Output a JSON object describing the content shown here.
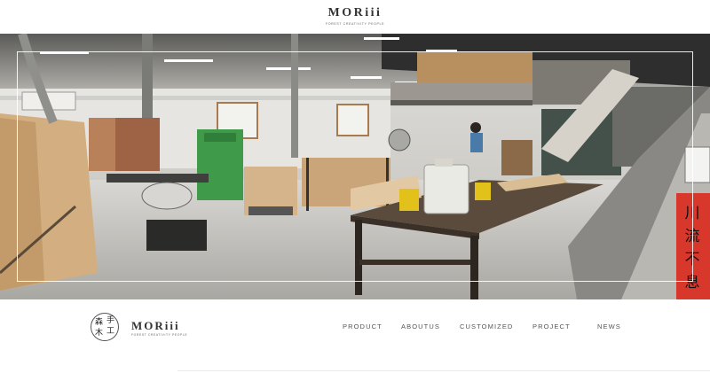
{
  "brand": {
    "wordmark": "MORiii",
    "tagline": "FOREST CREATIVITY PEOPLE",
    "seal_chars": [
      "森",
      "手",
      "木",
      "工"
    ]
  },
  "hero": {
    "image_description_icon": "workshop-photo",
    "banner_chars": "川流不息"
  },
  "nav": {
    "items": [
      {
        "label": "PRODUCT"
      },
      {
        "label": "ABOUTUS"
      },
      {
        "label": "CUSTOMIZED"
      },
      {
        "label": "PROJECT"
      },
      {
        "label": "NEWS"
      }
    ]
  },
  "colors": {
    "text": "#333333",
    "nav_text": "#555555",
    "banner_red": "#d8382c",
    "machine_green": "#3f9a4a"
  }
}
